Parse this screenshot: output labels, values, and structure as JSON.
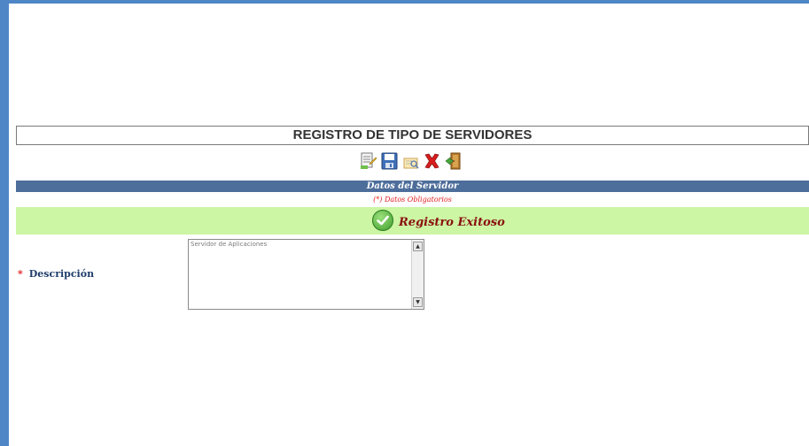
{
  "page": {
    "title": "REGISTRO DE TIPO DE SERVIDORES",
    "section_header": "Datos del Servidor",
    "required_note": "(*) Datos Obligatorios"
  },
  "toolbar": {
    "buttons": [
      {
        "icon": "new-document-icon"
      },
      {
        "icon": "save-disk-icon"
      },
      {
        "icon": "search-edit-icon"
      },
      {
        "icon": "delete-x-icon"
      },
      {
        "icon": "exit-door-icon"
      }
    ]
  },
  "message": {
    "text": "Registro Exitoso",
    "icon": "check-circle-icon",
    "color": "#ccf5a4"
  },
  "form": {
    "descripcion": {
      "required_mark": "*",
      "label": "Descripción",
      "value": "Servidor de Aplicaciones"
    }
  },
  "colors": {
    "frame": "#4f86c6",
    "section_header": "#4d6d9a",
    "success_text": "#8a1010",
    "required": "#e02020"
  }
}
